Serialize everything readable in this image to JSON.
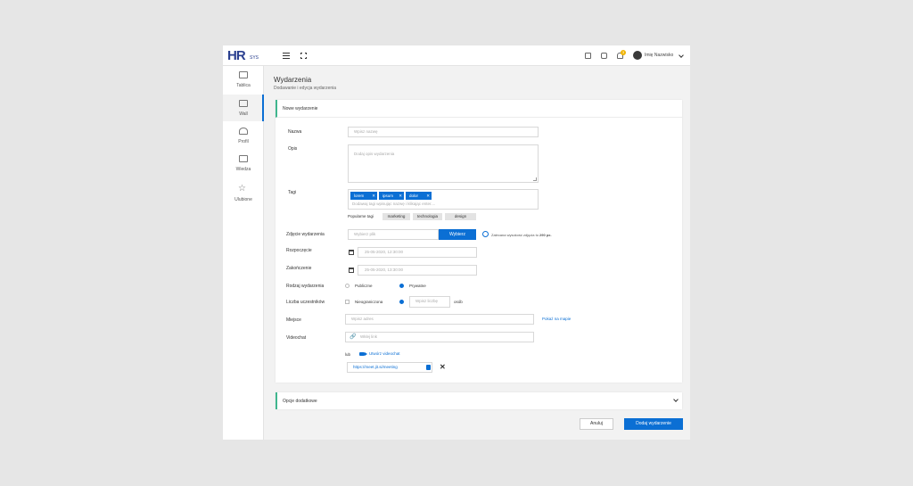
{
  "header": {
    "logo_main": "HR",
    "logo_sub": "SYS",
    "notifications_count": "3",
    "user_name": "Imię Nazwisko"
  },
  "sidebar": {
    "items": [
      {
        "label": "Tablica",
        "icon": "monitor-icon"
      },
      {
        "label": "Wall",
        "icon": "wall-icon",
        "active": true
      },
      {
        "label": "Profil",
        "icon": "user-icon"
      },
      {
        "label": "Wiedza",
        "icon": "knowledge-icon"
      },
      {
        "label": "Ulubione",
        "icon": "star-icon"
      }
    ]
  },
  "page": {
    "title": "Wydarzenia",
    "subtitle": "Dodawanie i edycja wydarzenia"
  },
  "form": {
    "section_title": "Nowe wydarzenie",
    "name_label": "Nazwa",
    "name_placeholder": "Wpisz nazwę",
    "desc_label": "Opis",
    "desc_placeholder": "Dodaj opis wydarzenia",
    "tags_label": "Tagi",
    "tags": [
      "lorem",
      "ipsum",
      "dolor"
    ],
    "tags_placeholder": "Dodawaj tagi wpisując nazwę i klikając enter....",
    "popular_label": "Popularne tagi",
    "popular_tags": [
      "marketing",
      "technologia",
      "design"
    ],
    "photo_label": "Zdjęcie wydarzenia",
    "photo_placeholder": "Wybierz plik",
    "photo_button": "Wybierz",
    "photo_hint_prefix": "Zalecana wysokość zdjęcia to",
    "photo_hint_value": "290 px.",
    "start_label": "Rozpoczęcie",
    "start_value": "25-05-2020, 12:30:00",
    "end_label": "Zakończenie",
    "end_value": "25-05-2020, 13:30:00",
    "type_label": "Rodzaj wydarzenia",
    "type_options": [
      "Publiczne",
      "Prywatne"
    ],
    "type_selected": "Prywatne",
    "participants_label": "Liczba uczestników",
    "participants_unlimited": "Nieograniczona",
    "participants_placeholder": "Wpisz liczbę",
    "participants_unit": "osób",
    "place_label": "Miejsce",
    "place_placeholder": "Wpisz adres",
    "place_map_link": "Pokaż na mapie",
    "videochat_label": "Videochat",
    "videochat_placeholder": "Wklej link",
    "videochat_or": "lub",
    "videochat_create": "Utwórz videochat",
    "videochat_link": "https://meet.jit.si/meeting"
  },
  "extra": {
    "title": "Opcje dodatkowe"
  },
  "actions": {
    "cancel": "Anuluj",
    "submit": "Dodaj wydarzenie"
  },
  "colors": {
    "accent": "#0b6fd4",
    "section_marker": "#3fb68e",
    "badge": "#f0b400"
  }
}
